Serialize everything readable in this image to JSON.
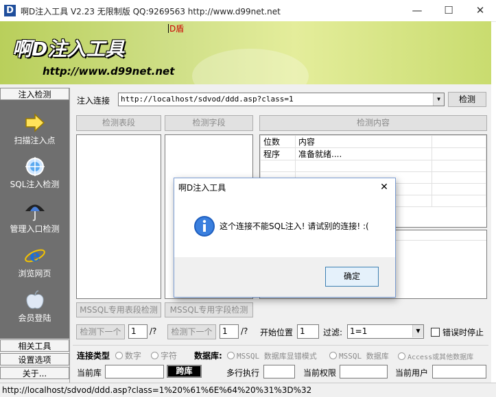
{
  "window": {
    "app_icon_letter": "D",
    "title": "啊D注入工具 V2.23 无限制版 QQ:9269563 http://www.d99net.net",
    "minimize_glyph": "—",
    "maximize_glyph": "☐",
    "close_glyph": "✕"
  },
  "menu": {
    "dshield": "D盾"
  },
  "banner": {
    "logo": "啊D注入工具",
    "url": "http://www.d99net.net"
  },
  "sidebar": {
    "header_top": "注入检测",
    "items": [
      {
        "label": "扫描注入点",
        "icon": "arrow-right-icon"
      },
      {
        "label": "SQL注入检测",
        "icon": "scan-target-icon"
      },
      {
        "label": "管理入口检测",
        "icon": "umbrella-icon"
      },
      {
        "label": "浏览网页",
        "icon": "internet-explorer-icon"
      },
      {
        "label": "会员登陆",
        "icon": "apple-icon"
      }
    ],
    "footer_items": [
      "相关工具",
      "设置选项",
      "关于..."
    ]
  },
  "main": {
    "url_label": "注入连接",
    "url_value": "http://localhost/sdvod/ddd.asp?class=1",
    "check_button": "检测",
    "detect_tables_button": "检测表段",
    "detect_fields_button": "检测字段",
    "detect_content_button": "检测内容",
    "content_grid": {
      "headers": [
        "位数",
        "内容"
      ],
      "rows": [
        [
          "程序",
          "准备就绪...."
        ]
      ]
    },
    "mssql_tables_button": "MSSQL专用表段检测",
    "mssql_fields_button": "MSSQL专用字段检测",
    "next_table_button": "检测下一个",
    "next_table_value": "1",
    "next_table_suffix": "/?",
    "next_field_button": "检测下一个",
    "next_field_value": "1",
    "next_field_suffix": "/?",
    "start_pos_label": "开始位置",
    "start_pos_value": "1",
    "filter_label": "过滤:",
    "filter_value": "1=1",
    "stop_on_error_label": "错误时停止",
    "conn_type_label": "连接类型",
    "conn_type_options": [
      "数字",
      "字符"
    ],
    "db_label": "数据库:",
    "db_options": [
      "MSSQL 数据库显错模式",
      "MSSQL 数据库",
      "Access或其他数据库"
    ],
    "current_db_label": "当前库",
    "current_db_value": "",
    "exploit_button": "跨库",
    "multi_exec_label": "多行执行",
    "multi_exec_value": "",
    "current_perm_label": "当前权限",
    "current_perm_value": "",
    "current_user_label": "当前用户",
    "current_user_value": ""
  },
  "status": {
    "text": "http://localhost/sdvod/ddd.asp?class=1%20%61%6E%64%20%31%3D%32"
  },
  "dialog": {
    "title": "啊D注入工具",
    "close_glyph": "✕",
    "message": "这个连接不能SQL注入! 请试别的连接!  :(",
    "ok_button": "确定",
    "icon": "info-icon"
  }
}
